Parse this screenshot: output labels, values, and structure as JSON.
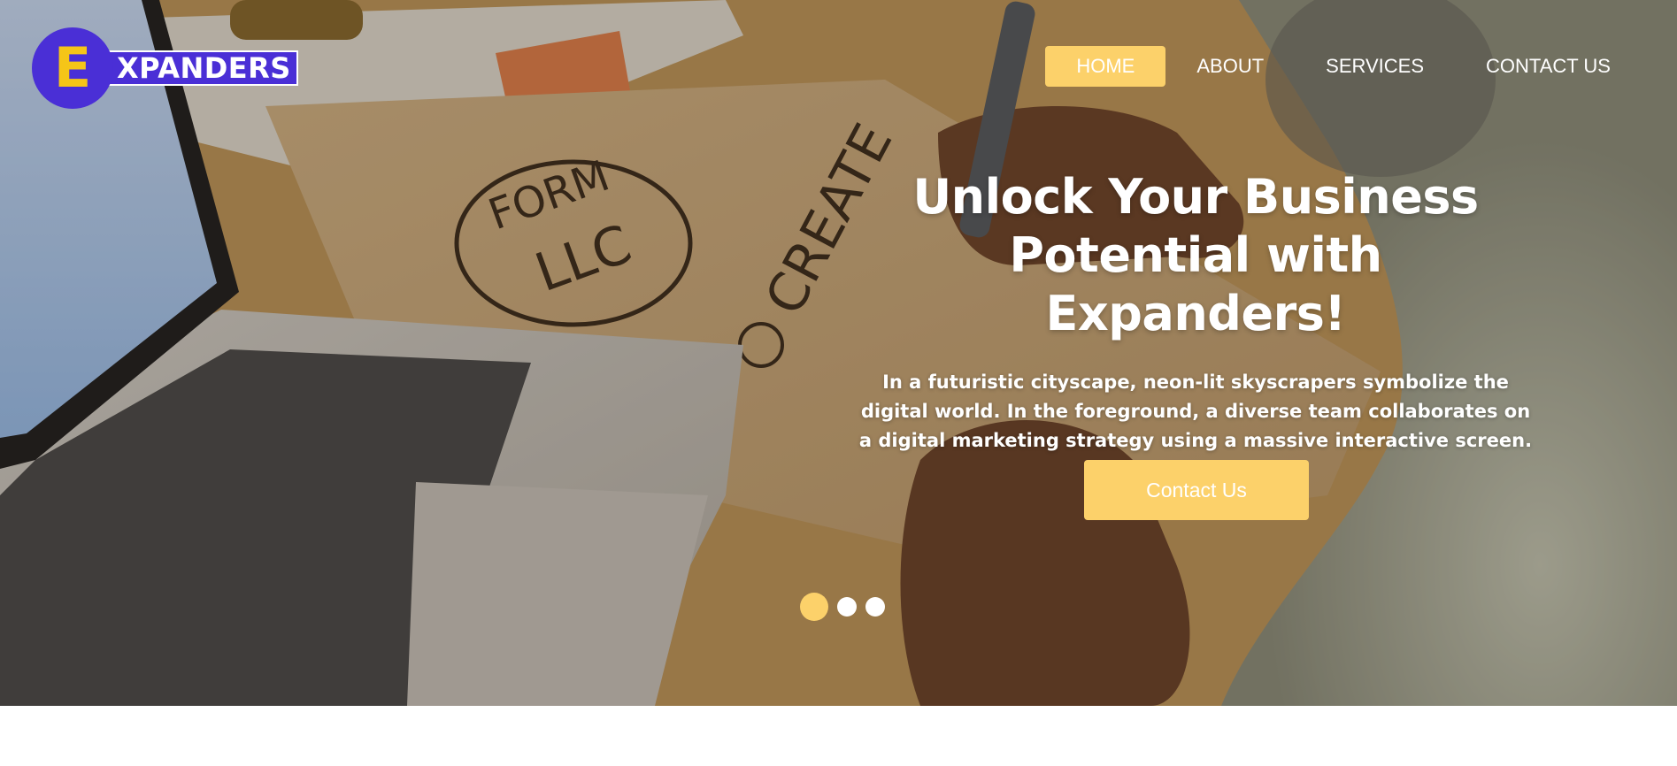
{
  "brand": {
    "logo_mark": "E",
    "logo_text": "XPANDERS",
    "colors": {
      "primary": "#4a2fd6",
      "accent": "#fcd16a",
      "mark": "#f5c518"
    }
  },
  "nav": {
    "items": [
      {
        "label": "HOME",
        "active": true
      },
      {
        "label": "ABOUT",
        "active": false
      },
      {
        "label": "SERVICES",
        "active": false
      },
      {
        "label": "CONTACT US",
        "active": false
      }
    ]
  },
  "hero": {
    "title_line1": "Unlock Your Business",
    "title_line2": "Potential with Expanders!",
    "description": "In a futuristic cityscape, neon-lit skyscrapers symbolize the digital world. In the foreground, a diverse team collaborates on a digital marketing strategy using a massive interactive screen.",
    "cta_label": "Contact Us",
    "slides": {
      "count": 3,
      "active_index": 1
    }
  }
}
